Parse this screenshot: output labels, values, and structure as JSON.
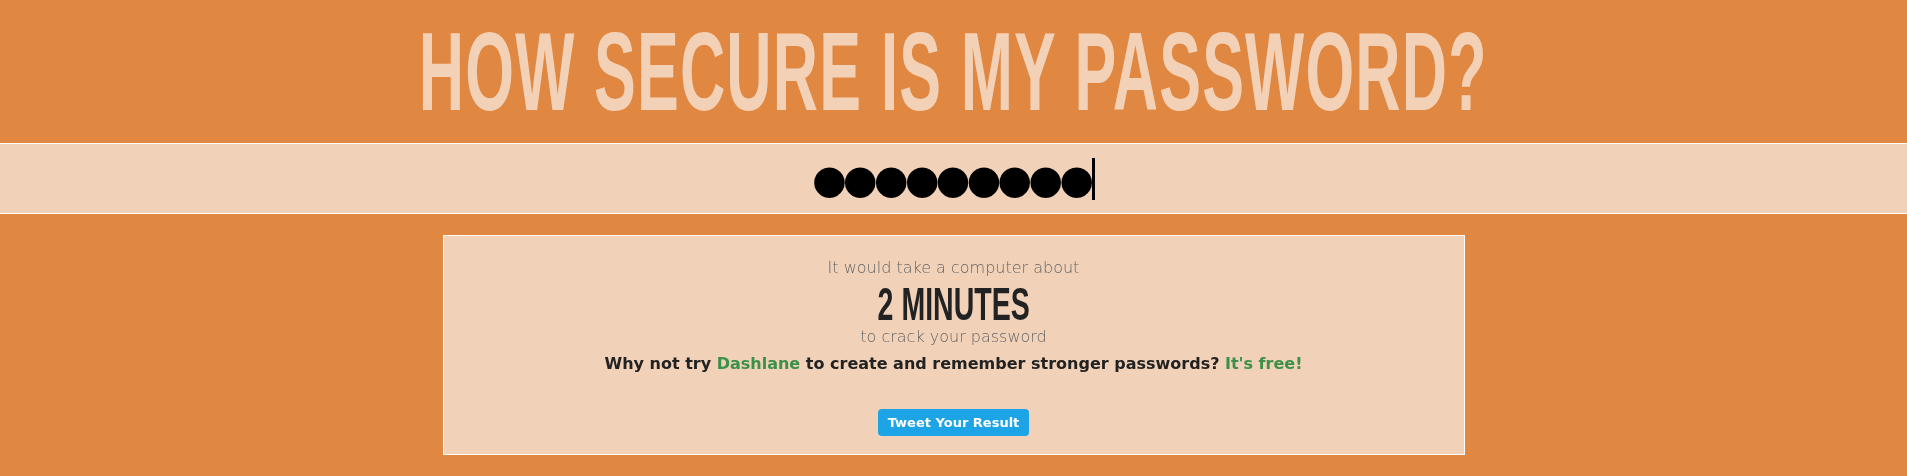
{
  "title": "HOW SECURE IS MY PASSWORD?",
  "password": {
    "value": "●●●●●●●●●",
    "focused": true
  },
  "result": {
    "intro": "It would take a computer about",
    "time": "2 MINUTES",
    "outro": "to crack your password",
    "promo": {
      "before": "Why not try ",
      "link": "Dashlane",
      "middle": " to create and remember stronger passwords? ",
      "link2": "It's free!"
    },
    "button": "Tweet Your Result"
  }
}
